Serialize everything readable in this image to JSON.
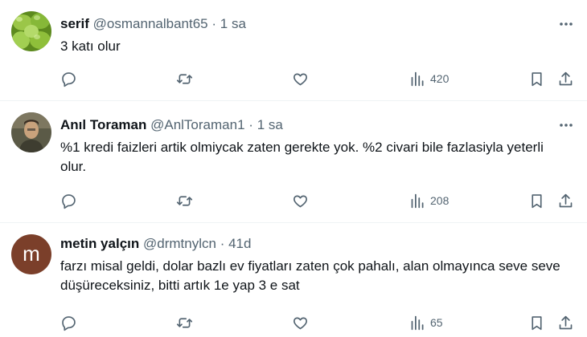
{
  "tweets": [
    {
      "name": "serif",
      "handle": "@osmannalbant65",
      "separator": "·",
      "time": "1 sa",
      "text": "3 katı olur",
      "views": "420",
      "avatar": {
        "type": "olives",
        "colors": [
          "#8fbf3a",
          "#6a9f22",
          "#a6cf4e"
        ]
      }
    },
    {
      "name": "Anıl Toraman",
      "handle": "@AnlToraman1",
      "separator": "·",
      "time": "1 sa",
      "text": "%1 kredi faizleri artik olmiycak zaten gerekte yok. %2 civari bile fazlasiyla yeterli olur.",
      "views": "208",
      "avatar": {
        "type": "photo",
        "colors": [
          "#4a4a3a",
          "#8a7a60",
          "#c9b08a"
        ]
      }
    },
    {
      "name": "metin yalçın",
      "handle": "@drmtnylcn",
      "separator": "·",
      "time": "41d",
      "text": "farzı misal geldi, dolar bazlı ev fiyatları zaten çok pahalı, alan olmayınca seve seve düşüreceksiniz, bitti artık 1e yap 3 e sat",
      "views": "65",
      "avatar": {
        "type": "letter",
        "letter": "m",
        "colors": [
          "#7b3f2a"
        ]
      }
    }
  ],
  "icons": {
    "reply": "reply-icon",
    "retweet": "retweet-icon",
    "like": "like-icon",
    "views": "views-icon",
    "bookmark": "bookmark-icon",
    "share": "share-icon",
    "more": "more-icon"
  },
  "colors": {
    "text": "#0f1419",
    "secondary": "#536471",
    "divider": "#eff3f4"
  }
}
